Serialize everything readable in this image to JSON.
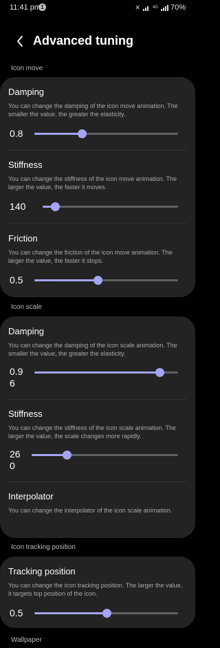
{
  "status_bar": {
    "time": "11:41 pm",
    "notification_count": "1",
    "network": "4G",
    "battery": "70%"
  },
  "header": {
    "title": "Advanced tuning",
    "back_icon": "chevron-left-icon"
  },
  "colors": {
    "accent": "#a5a3f2",
    "card": "#232323",
    "background": "#000000"
  },
  "sections": {
    "icon_move": {
      "label": "Icon move",
      "damping": {
        "title": "Damping",
        "desc": "You can change the damping of the icon move animation. The smaller the value, the greater the elasticity.",
        "value": "0.8",
        "level": 0.33
      },
      "stiffness": {
        "title": "Stiffness",
        "desc": "You can change the stiffness of the icon move animation. The larger the value, the faster it moves.",
        "value": "140",
        "level": 0.09
      },
      "friction": {
        "title": "Friction",
        "desc": "You can change the friction of the icon move animation. The larger the value, the faster it stops.",
        "value": "0.5",
        "level": 0.44
      }
    },
    "icon_scale": {
      "label": "Icon scale",
      "damping": {
        "title": "Damping",
        "desc": "You can change the damping of the icon scale animation. The smaller the value, the greater the elasticity.",
        "value_line1": "0.9",
        "value_line2": "6",
        "level": 0.87
      },
      "stiffness": {
        "title": "Stiffness",
        "desc": "You can change the stiffness of the icon scale animation. The larger the value, the scale changes more rapidly.",
        "value_line1": "26",
        "value_line2": "0",
        "level": 0.24
      },
      "interpolator": {
        "title": "Interpolator",
        "desc": "You can change the interpolator of the icon scale animation."
      }
    },
    "icon_tracking": {
      "label": "Icon tracking position",
      "tracking": {
        "title": "Tracking position",
        "desc": "You can change the icon tracking position. The larger the value, it targets top position of the icon.",
        "value": "0.5",
        "level": 0.5
      }
    },
    "wallpaper": {
      "label": "Wallpaper"
    }
  }
}
